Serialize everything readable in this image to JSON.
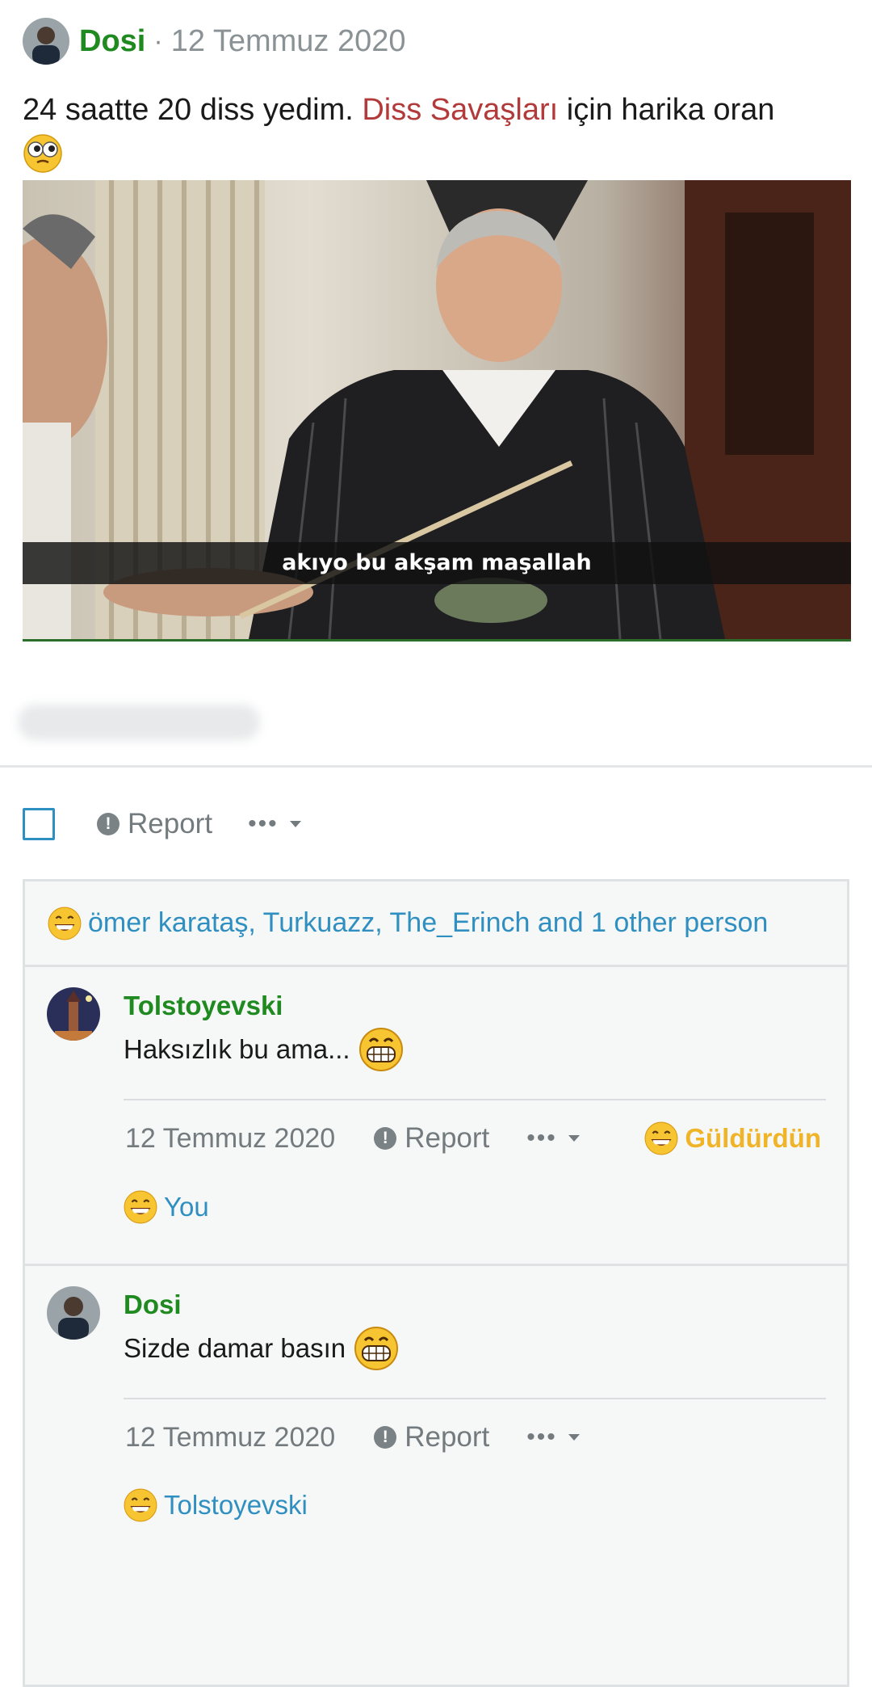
{
  "post": {
    "author": "Dosi",
    "separator": "·",
    "date": "12 Temmuz 2020",
    "text_before": "24 saatte 20 diss yedim.",
    "text_link": "Diss Savaşları",
    "text_after": "için harika oran",
    "image_caption": "akıyo bu akşam maşallah"
  },
  "actions": {
    "report_label": "Report",
    "more_label": "•••"
  },
  "reactions": {
    "summary": "ömer karataş, Turkuazz, The_Erinch and 1 other person"
  },
  "comments": [
    {
      "author": "Tolstoyevski",
      "text": "Haksızlık bu ama...",
      "date": "12 Temmuz 2020",
      "report_label": "Report",
      "more_label": "•••",
      "laugh_label": "Güldürdün",
      "reacted_by": "You"
    },
    {
      "author": "Dosi",
      "text": "Sizde damar basın",
      "date": "12 Temmuz 2020",
      "report_label": "Report",
      "more_label": "•••",
      "reacted_by": "Tolstoyevski"
    }
  ],
  "colors": {
    "author_green": "#1f8a1f",
    "link_red": "#b23a3a",
    "link_blue": "#2f8fc0",
    "laugh_yellow": "#f0b429",
    "meta_gray": "#737b7e"
  }
}
